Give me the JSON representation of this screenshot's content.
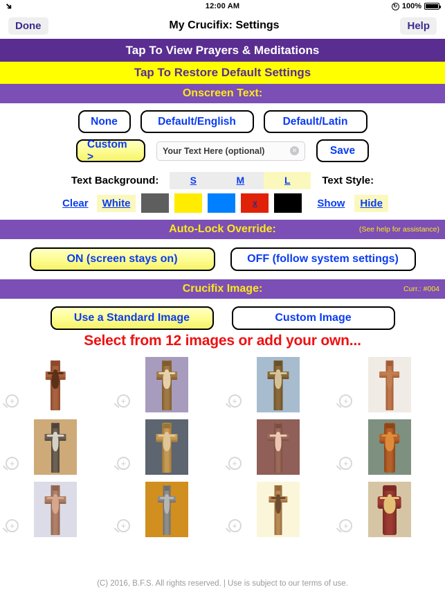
{
  "status_bar": {
    "airplane_icon": "airplane-mode-icon",
    "time": "12:00 AM",
    "lock_icon": "rotation-lock-icon",
    "battery_percent": "100%",
    "battery_icon": "battery-full-icon"
  },
  "nav": {
    "done_label": "Done",
    "title": "My Crucifix: Settings",
    "help_label": "Help"
  },
  "banners": {
    "prayers": "Tap To View Prayers & Meditations",
    "restore": "Tap To Restore Default Settings",
    "onscreen_text": "Onscreen Text:",
    "auto_lock": "Auto-Lock Override:",
    "auto_lock_note": "(See help for assistance)",
    "crucifix_image": "Crucifix Image:",
    "crucifix_note": "Curr.: #004"
  },
  "onscreen_text": {
    "options": [
      {
        "label": "None",
        "selected": false
      },
      {
        "label": "Default/English",
        "selected": false
      },
      {
        "label": "Default/Latin",
        "selected": false
      }
    ],
    "custom_label": "Custom >",
    "custom_selected": true,
    "custom_input_value": "",
    "custom_input_placeholder": "Your Text Here (optional)",
    "clear_icon": "clear-text-icon",
    "save_label": "Save"
  },
  "text_background": {
    "label": "Text Background:",
    "sizes": [
      {
        "label": "S",
        "selected": false
      },
      {
        "label": "M",
        "selected": false
      },
      {
        "label": "L",
        "selected": true
      }
    ],
    "clear_label": "Clear",
    "clear_selected": false,
    "white_label": "White",
    "white_selected": true,
    "swatches": [
      {
        "name": "gray-swatch",
        "color": "#5e5e5e",
        "selected": false
      },
      {
        "name": "yellow-swatch",
        "color": "#ffec00",
        "selected": false
      },
      {
        "name": "blue-swatch",
        "color": "#0080ff",
        "selected": false
      },
      {
        "name": "red-swatch",
        "color": "#e02208",
        "selected": true
      },
      {
        "name": "black-swatch",
        "color": "#000000",
        "selected": false
      }
    ],
    "selected_marker": "x"
  },
  "text_style": {
    "label": "Text Style:",
    "show_label": "Show",
    "show_selected": false,
    "hide_label": "Hide",
    "hide_selected": true
  },
  "auto_lock": {
    "on_label": "ON (screen stays on)",
    "on_selected": true,
    "off_label": "OFF (follow system settings)",
    "off_selected": false
  },
  "crucifix_image": {
    "standard_label": "Use a Standard Image",
    "standard_selected": true,
    "custom_label": "Custom Image",
    "custom_selected": false,
    "headline": "Select from 12 images or add your own...",
    "magnifier_icon": "magnifier-zoom-icon",
    "thumbnails": [
      {
        "id": "001",
        "bg": "#ffffff",
        "wood": "#a9623e",
        "wood_dark": "#8b4a2c",
        "body": "#5a3018",
        "post_w": 14,
        "arm_w": 46,
        "style": "plain"
      },
      {
        "id": "002",
        "bg": "#a79cbd",
        "wood": "#a07a45",
        "wood_dark": "#7f5c2e",
        "body": "#e8d3b0",
        "post_w": 14,
        "arm_w": 48,
        "style": "gilded"
      },
      {
        "id": "003",
        "bg": "#a7bcce",
        "wood": "#8a6a3a",
        "wood_dark": "#6b4f27",
        "body": "#d8c49a",
        "post_w": 13,
        "arm_w": 50,
        "style": "gilded"
      },
      {
        "id": "004",
        "bg": "#f0ebe4",
        "wood": "#c0754a",
        "wood_dark": "#9e5c36",
        "body": "#c08050",
        "post_w": 11,
        "arm_w": 48,
        "style": "plain"
      },
      {
        "id": "005",
        "bg": "#ceaa78",
        "wood": "#6e6055",
        "wood_dark": "#4e443c",
        "body": "#d9d4c8",
        "post_w": 12,
        "arm_w": 50,
        "style": "stone"
      },
      {
        "id": "006",
        "bg": "#5c6570",
        "wood": "#c59a54",
        "wood_dark": "#9a7437",
        "body": "#e0c69a",
        "post_w": 14,
        "arm_w": 50,
        "style": "sky"
      },
      {
        "id": "007",
        "bg": "#8f5f58",
        "wood": "#9c6a5a",
        "wood_dark": "#7a4f42",
        "body": "#f0c8b6",
        "post_w": 12,
        "arm_w": 50,
        "style": "plain"
      },
      {
        "id": "008",
        "bg": "#7e9080",
        "wood": "#b5612a",
        "wood_dark": "#8c4619",
        "body": "#e08c3a",
        "post_w": 16,
        "arm_w": 48,
        "style": "round"
      },
      {
        "id": "009",
        "bg": "#dcdce8",
        "wood": "#b08068",
        "wood_dark": "#8e6450",
        "body": "#d8a88c",
        "post_w": 13,
        "arm_w": 50,
        "style": "pale"
      },
      {
        "id": "010",
        "bg": "#d08f1e",
        "wood": "#8d8d8d",
        "wood_dark": "#6d6d6d",
        "body": "#b8b8b8",
        "post_w": 11,
        "arm_w": 42,
        "style": "silver"
      },
      {
        "id": "011",
        "bg": "#fbf6da",
        "wood": "#b98a55",
        "wood_dark": "#96693a",
        "body": "#6b4a30",
        "post_w": 11,
        "arm_w": 44,
        "style": "plain"
      },
      {
        "id": "012",
        "bg": "#d6c5a4",
        "wood": "#9c3a33",
        "wood_dark": "#7b2a24",
        "body": "#e5c478",
        "post_w": 20,
        "arm_w": 56,
        "style": "icon"
      }
    ]
  },
  "footer": {
    "text": "(C) 2016, B.F.S. All rights reserved. | Use is subject to our terms of use."
  }
}
